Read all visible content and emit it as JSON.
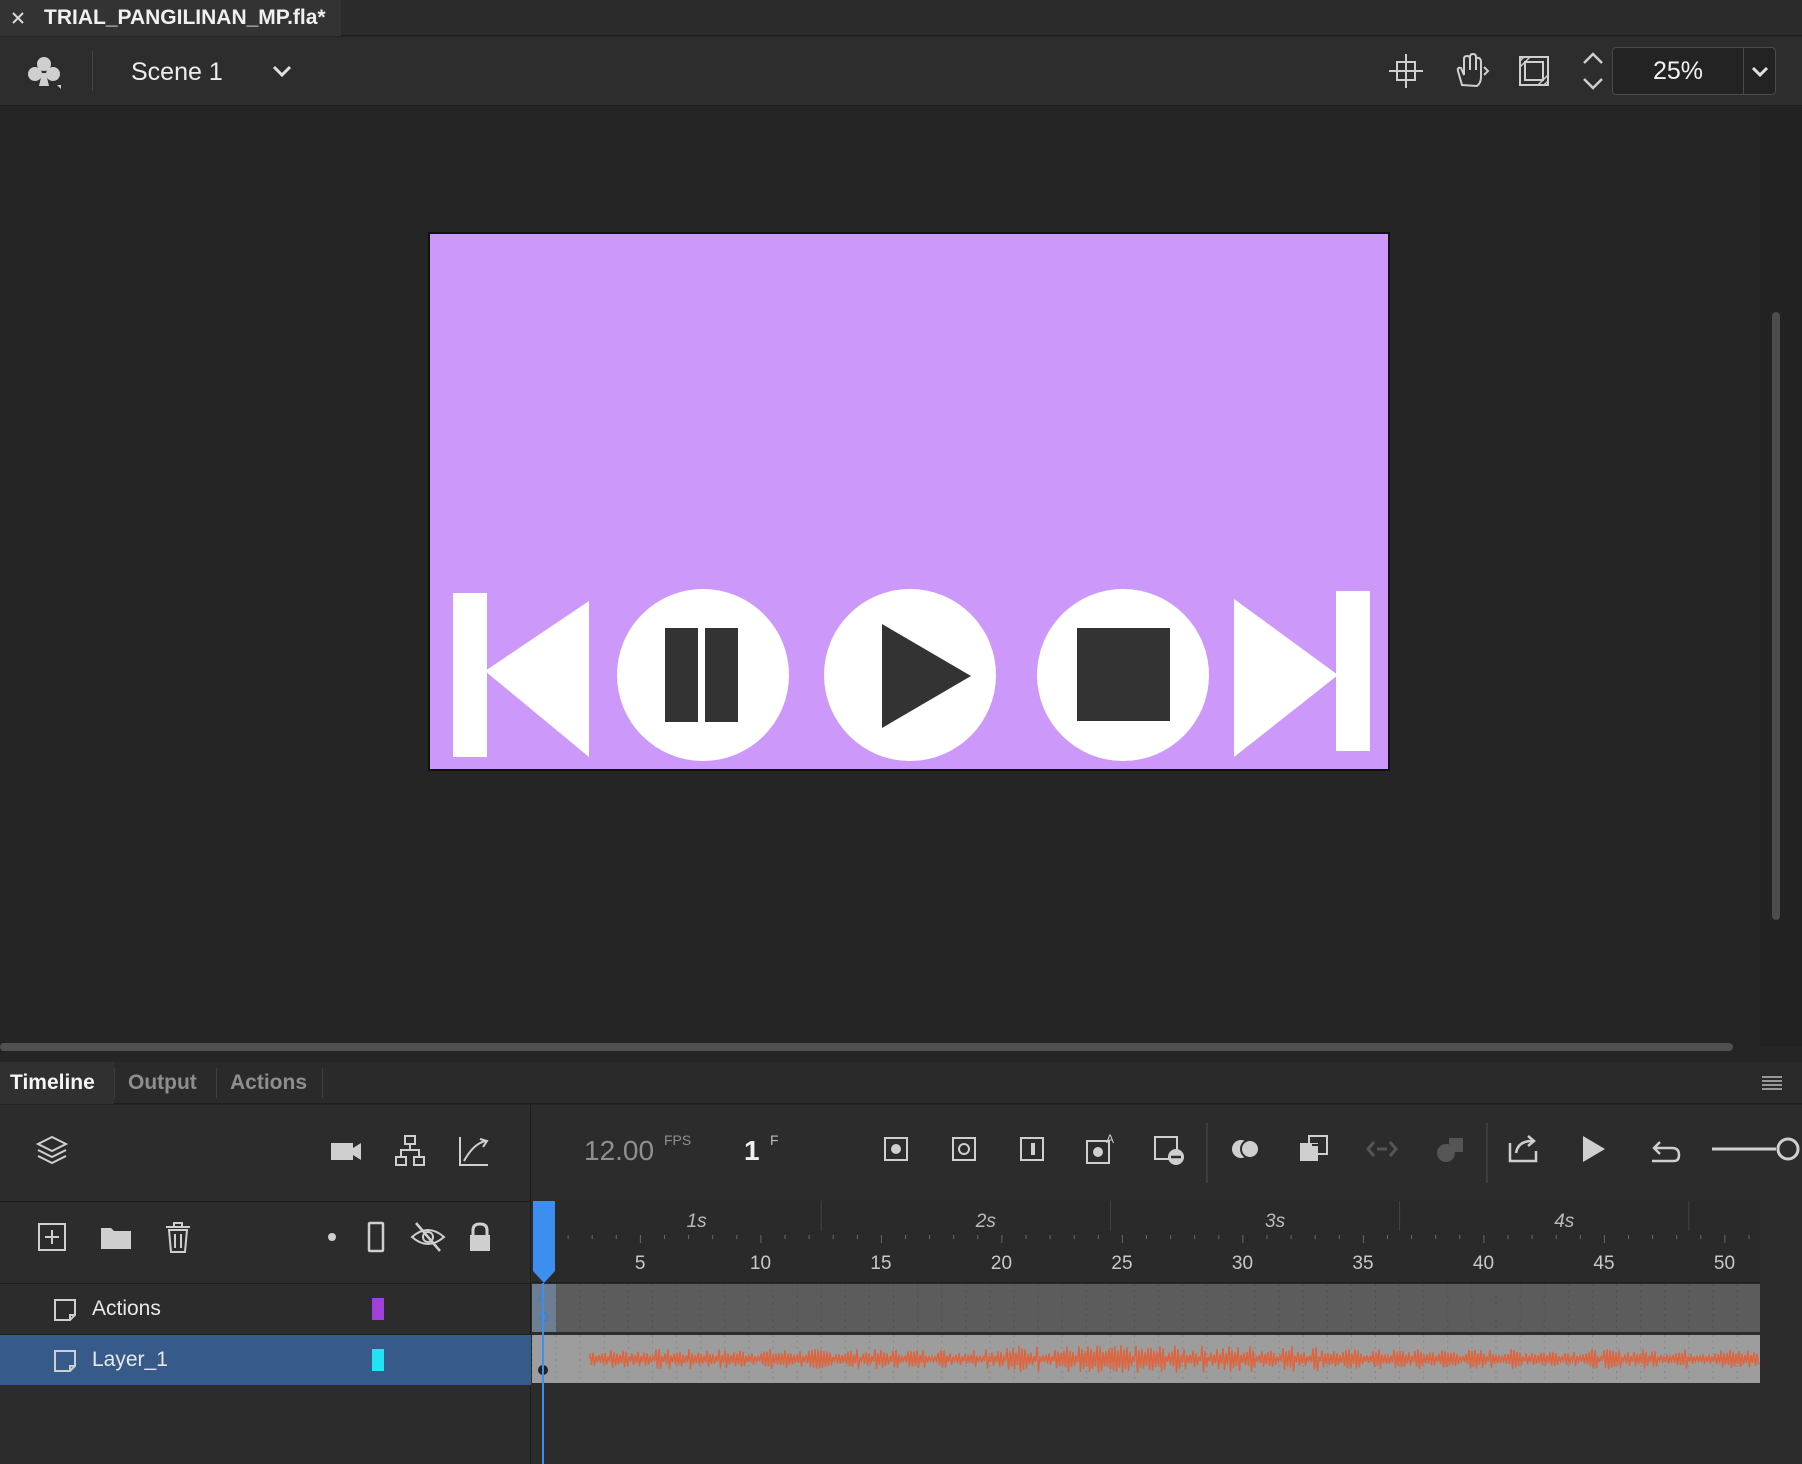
{
  "document": {
    "tab_title": "TRIAL_PANGILINAN_MP.fla*"
  },
  "edit_bar": {
    "scene_name": "Scene 1",
    "zoom_value": "25%"
  },
  "stage": {
    "background_color": "#cc99fb",
    "controls": [
      "skip-back",
      "pause",
      "play",
      "stop",
      "skip-forward"
    ]
  },
  "panel_tabs": [
    "Timeline",
    "Output",
    "Actions"
  ],
  "timeline": {
    "fps_value": "12.00",
    "fps_unit": "FPS",
    "current_frame": "1",
    "frame_unit": "F",
    "second_markers": [
      "1s",
      "2s",
      "3s",
      "4s"
    ],
    "frame_markers": [
      "5",
      "10",
      "15",
      "20",
      "25",
      "30",
      "35",
      "40",
      "45",
      "50"
    ],
    "layers": [
      {
        "name": "Actions",
        "color": "#a040d8",
        "selected": false
      },
      {
        "name": "Layer_1",
        "color": "#20e4f4",
        "selected": true
      }
    ],
    "audio_waveform_color": "#e0633c"
  }
}
